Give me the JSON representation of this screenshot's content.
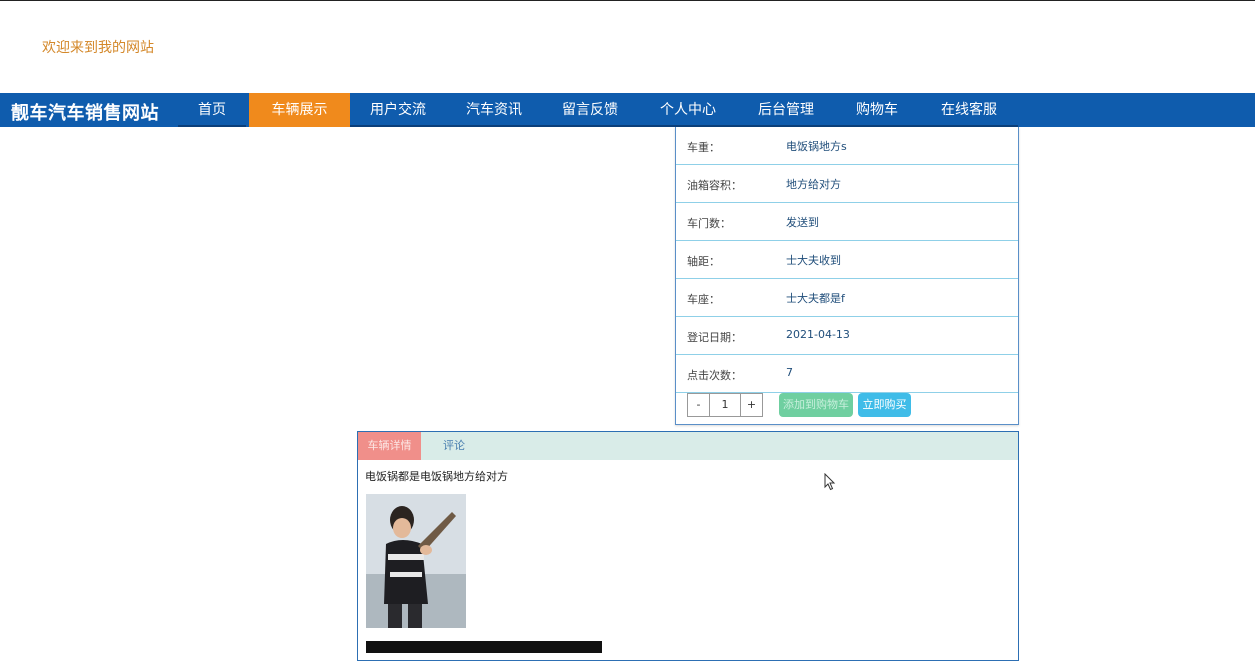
{
  "header": {
    "welcome": "欢迎来到我的网站"
  },
  "nav": {
    "brand": "靓车汽车销售网站",
    "items": [
      {
        "label": "首页",
        "active": false
      },
      {
        "label": "车辆展示",
        "active": true
      },
      {
        "label": "用户交流",
        "active": false
      },
      {
        "label": "汽车资讯",
        "active": false
      },
      {
        "label": "留言反馈",
        "active": false
      },
      {
        "label": "个人中心",
        "active": false
      },
      {
        "label": "后台管理",
        "active": false
      },
      {
        "label": "购物车",
        "active": false
      },
      {
        "label": "在线客服",
        "active": false
      }
    ]
  },
  "info": {
    "rows": [
      {
        "label": "车重：",
        "value": "电饭锅地方s"
      },
      {
        "label": "油箱容积：",
        "value": "地方给对方"
      },
      {
        "label": "车门数：",
        "value": "发送到"
      },
      {
        "label": "轴距：",
        "value": "士大夫收到"
      },
      {
        "label": "车座：",
        "value": "士大夫都是f"
      },
      {
        "label": "登记日期：",
        "value": "2021-04-13"
      },
      {
        "label": "点击次数：",
        "value": "7"
      }
    ],
    "qty": {
      "minus": "-",
      "value": "1",
      "plus": "+"
    },
    "add_cart_label": "添加到购物车",
    "buy_now_label": "立即购买"
  },
  "detail": {
    "tabs": [
      {
        "label": "车辆详情",
        "active": true
      },
      {
        "label": "评论",
        "active": false
      }
    ],
    "description": "电饭锅都是电饭锅地方给对方"
  },
  "colors": {
    "nav_bg": "#0f5cad",
    "nav_active": "#f08a1c",
    "welcome_text": "#d4882a",
    "buy_button": "#3fbce8",
    "cart_button": "#6fcfa0",
    "tab_active": "#f08f8a"
  }
}
